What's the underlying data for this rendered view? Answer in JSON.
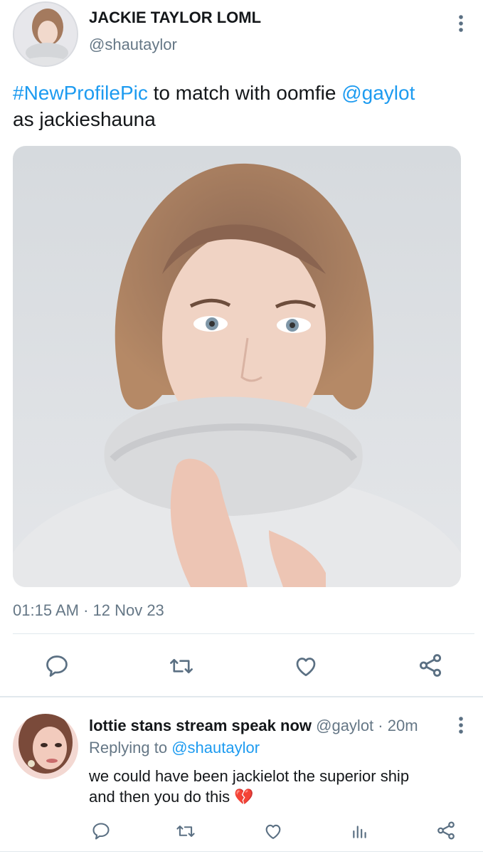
{
  "tweet": {
    "display_name": "JACKIE TAYLOR LOML",
    "handle": "@shautaylor",
    "hashtag": "#NewProfilePic",
    "text_mid": " to match with oomfie ",
    "mention": "@gaylot",
    "text_end": "as jackieshauna",
    "timestamp": "01:15 AM · 12 Nov 23"
  },
  "reply": {
    "display_name": "lottie stans stream speak now",
    "handle": "@gaylot",
    "time": "· 20m",
    "replying_label": "Replying to",
    "replying_handle": "@shautaylor",
    "text_line1": "we could have been jackielot the superior ship",
    "text_line2": "and then you do this",
    "emoji": "💔"
  },
  "icons": [
    "more-icon",
    "reply-icon",
    "retweet-icon",
    "like-icon",
    "share-icon",
    "analytics-icon"
  ],
  "colors": {
    "link": "#1d9bf0",
    "muted": "#657786",
    "icon": "#5b7083",
    "broken_heart": "#e0457b"
  }
}
